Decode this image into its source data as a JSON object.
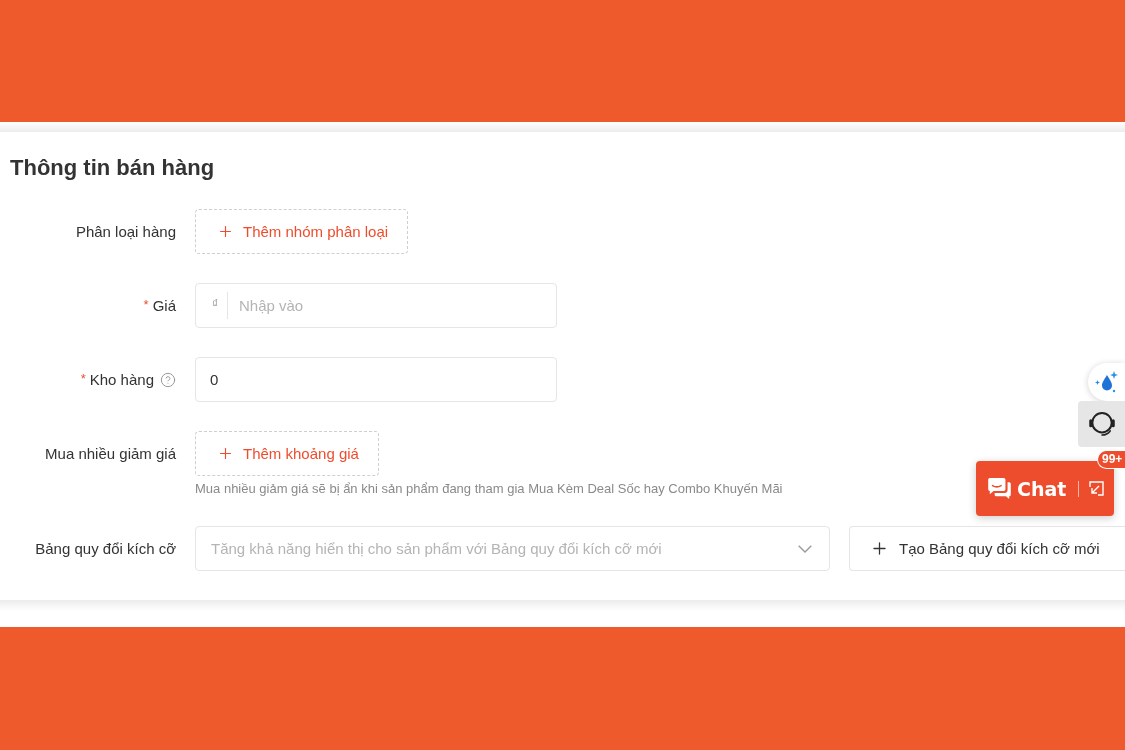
{
  "section": {
    "title": "Thông tin bán hàng"
  },
  "fields": [
    {
      "kind": "add_button",
      "label": "Phân loại hàng",
      "button": "Thêm nhóm phân loại"
    },
    {
      "kind": "input",
      "label": "Giá",
      "required_mark": "*",
      "prefix": "₫",
      "placeholder": "Nhập vào"
    },
    {
      "kind": "input",
      "label": "Kho hàng",
      "required_mark": "*",
      "help": true,
      "value": "0"
    },
    {
      "kind": "add_button",
      "label": "Mua nhiều giảm giá",
      "button": "Thêm khoảng giá",
      "hint": "Mua nhiều giảm giá sẽ bị ẩn khi sản phẩm đang tham gia Mua Kèm Deal Sốc hay Combo Khuyến Mãi"
    },
    {
      "kind": "select",
      "label": "Bảng quy đổi kích cỡ",
      "placeholder": "Tăng khả năng hiển thị cho sản phẩm với Bảng quy đổi kích cỡ mới",
      "action": "Tạo Bảng quy đổi kích cỡ mới"
    }
  ],
  "chat": {
    "label": "Chat",
    "badge": "99+"
  }
}
